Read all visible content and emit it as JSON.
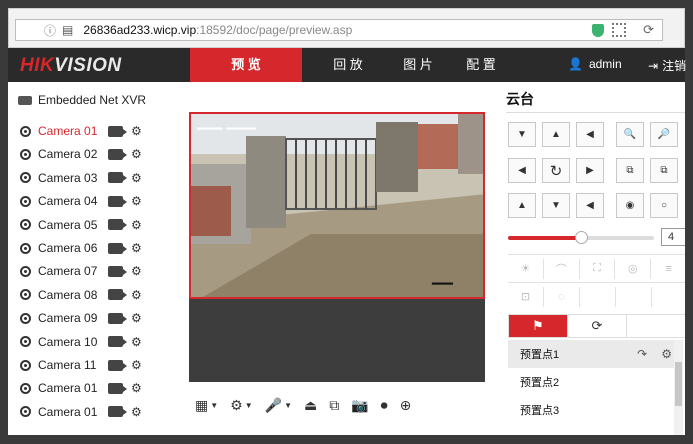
{
  "browser": {
    "url_host": "26836ad233.wicp.vip",
    "url_path": ":18592/doc/page/preview.asp"
  },
  "header": {
    "logo_hik": "HIK",
    "logo_vision": "VISION",
    "tabs": [
      {
        "label": "预 览",
        "active": true
      },
      {
        "label": "回 放",
        "active": false
      },
      {
        "label": "图 片",
        "active": false
      },
      {
        "label": "配 置",
        "active": false
      }
    ],
    "user": "admin",
    "logout": "注销"
  },
  "sidebar": {
    "device": "Embedded Net XVR",
    "cameras": [
      {
        "name": "Camera 01",
        "active": true
      },
      {
        "name": "Camera 02",
        "active": false
      },
      {
        "name": "Camera 03",
        "active": false
      },
      {
        "name": "Camera 04",
        "active": false
      },
      {
        "name": "Camera 05",
        "active": false
      },
      {
        "name": "Camera 06",
        "active": false
      },
      {
        "name": "Camera 07",
        "active": false
      },
      {
        "name": "Camera 08",
        "active": false
      },
      {
        "name": "Camera 09",
        "active": false
      },
      {
        "name": "Camera 10",
        "active": false
      },
      {
        "name": "Camera 11",
        "active": false
      },
      {
        "name": "Camera 01",
        "active": false
      },
      {
        "name": "Camera 01",
        "active": false
      }
    ]
  },
  "ptz": {
    "title": "云台",
    "speed_value": "4",
    "speed_level": 0.5,
    "preset_items": [
      "预置点1",
      "预置点2",
      "预置点3"
    ]
  },
  "colors": {
    "accent": "#d6282c",
    "header_bg": "#2a2a2a"
  }
}
